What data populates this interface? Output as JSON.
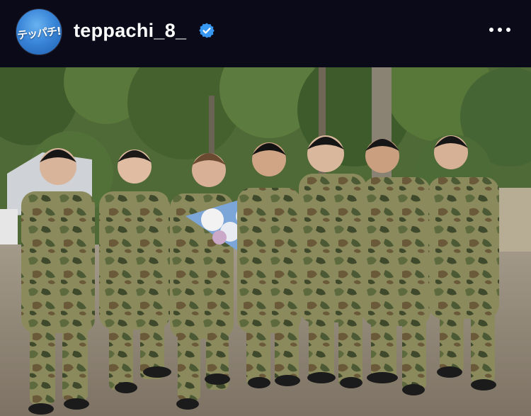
{
  "post": {
    "username": "teppachi_8_",
    "avatar_text": "テッパチ!",
    "verified_badge": "verified-check-icon",
    "more_icon": "more-horizontal-icon"
  },
  "photo": {
    "subject_count": 7
  },
  "colors": {
    "header_bg": "#0a0a18",
    "verified_blue": "#3897f0",
    "text": "#ffffff"
  }
}
